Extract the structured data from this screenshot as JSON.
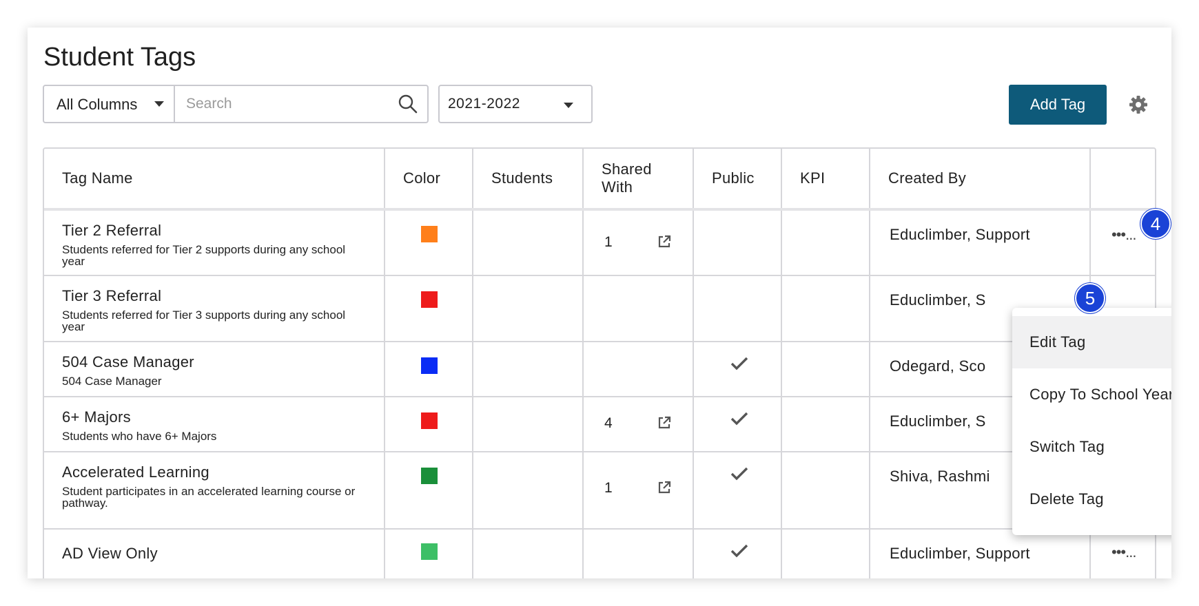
{
  "page": {
    "title": "Student Tags"
  },
  "toolbar": {
    "column_filter": "All Columns",
    "search_placeholder": "Search",
    "search_value": "",
    "year": "2021-2022",
    "add_button": "Add Tag"
  },
  "table": {
    "headers": [
      "Tag Name",
      "Color",
      "Students",
      "Shared With",
      "Public",
      "KPI",
      "Created By",
      ""
    ],
    "rows": [
      {
        "name": "Tier 2 Referral",
        "description": "Students referred for Tier 2 supports during any school year",
        "color": "#ff7f1a",
        "students": "",
        "shared": "1",
        "public": false,
        "kpi": "",
        "created_by": "Educlimber, Support",
        "menu": "•••..."
      },
      {
        "name": "Tier 3 Referral",
        "description": "Students referred for Tier 3 supports during any school year",
        "color": "#ee1b1b",
        "students": "",
        "shared": "",
        "public": false,
        "kpi": "",
        "created_by": "Educlimber, S",
        "menu": ""
      },
      {
        "name": "504 Case Manager",
        "description": "504 Case Manager",
        "color": "#0a2cf5",
        "students": "",
        "shared": "",
        "public": true,
        "kpi": "",
        "created_by": "Odegard, Sco",
        "menu": ""
      },
      {
        "name": "6+ Majors",
        "description": "Students who have 6+ Majors",
        "color": "#ee1b1b",
        "students": "",
        "shared": "4",
        "public": true,
        "kpi": "",
        "created_by": "Educlimber, S",
        "menu": ""
      },
      {
        "name": "Accelerated Learning",
        "description": "Student participates in an accelerated learning course or pathway.",
        "color": "#1a8f3a",
        "students": "",
        "shared": "1",
        "public": true,
        "kpi": "",
        "created_by": "Shiva, Rashmi",
        "menu": ""
      },
      {
        "name": "AD View Only",
        "description": "",
        "color": "#3dbf66",
        "students": "",
        "shared": "",
        "public": true,
        "kpi": "",
        "created_by": "Educlimber, Support",
        "menu": "•••..."
      }
    ]
  },
  "context_menu": {
    "items": [
      "Edit Tag",
      "Copy To School Year",
      "Switch Tag",
      "Delete Tag"
    ]
  },
  "steps": {
    "a": "4",
    "b": "5"
  },
  "colors": {
    "accent": "#0e5a7a",
    "step_badge": "#1a43d6"
  }
}
